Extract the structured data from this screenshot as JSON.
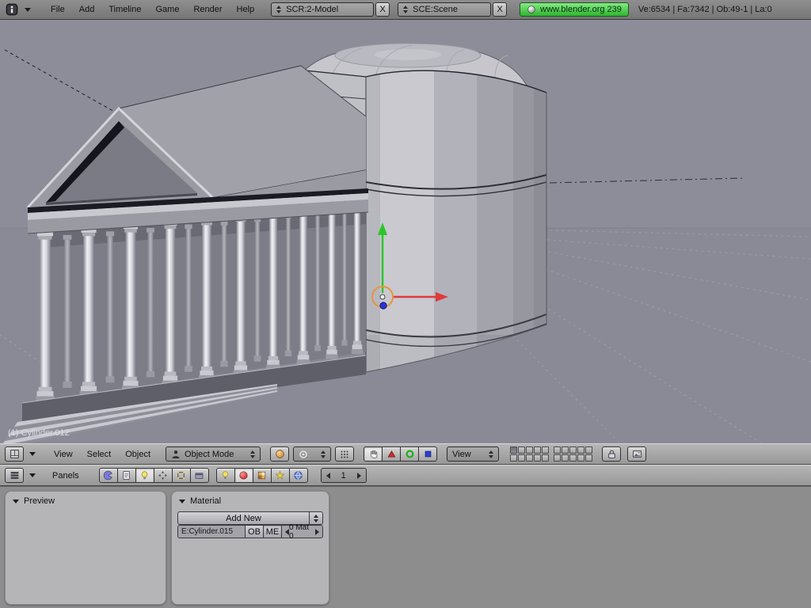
{
  "colors": {
    "version_button_green": "#3fcf3f",
    "manipulator_green": "#2bc42b",
    "manipulator_red": "#e03a3a",
    "manipulator_blue": "#2a35d4",
    "manipulator_orange": "#e6953a",
    "viewport_background": "#8d8d9a"
  },
  "icons": {
    "top_window_type": "info-icon",
    "viewport_window_type": "3d-view-icon",
    "buttons_window_type": "buttons-window-icon",
    "mode": "person-icon",
    "draw_type": "sphere-icon",
    "pivot": "pivot-point-icon",
    "snap": "grid-dots-icon",
    "manipulator": [
      "hand-icon",
      "translate-icon",
      "rotate-icon",
      "scale-icon"
    ],
    "contexts": [
      "logic-icon",
      "script-icon",
      "shading-icon",
      "object-icon",
      "editing-icon",
      "scene-icon"
    ],
    "shading_subcontexts": [
      "lamp-icon",
      "material-icon",
      "texture-icon",
      "radiosity-icon",
      "world-icon"
    ],
    "lock": "lock-icon",
    "render_preview": "image-icon"
  },
  "top_menu": {
    "menus": [
      "File",
      "Add",
      "Timeline",
      "Game",
      "Render",
      "Help"
    ],
    "screen_field": "SCR:2-Model",
    "screen_close": "X",
    "scene_field": "SCE:Scene",
    "scene_close": "X",
    "version_label": "www.blender.org 239",
    "stats": "Ve:6534 | Fa:7342 | Ob:49-1 | La:0"
  },
  "viewport": {
    "object_label": "(1) Cylinder.012",
    "header": {
      "menu_view": "View",
      "menu_select": "Select",
      "menu_object": "Object",
      "mode": "Object Mode",
      "orientation": "View"
    }
  },
  "buttons_header": {
    "panels_label": "Panels",
    "frame": "1"
  },
  "material_panel": {
    "preview_title": "Preview",
    "material_title": "Material",
    "add_new": "Add New",
    "name_field": "E:Cylinder.015",
    "ob": "OB",
    "me": "ME",
    "mat_count": "0 Mat 0"
  }
}
